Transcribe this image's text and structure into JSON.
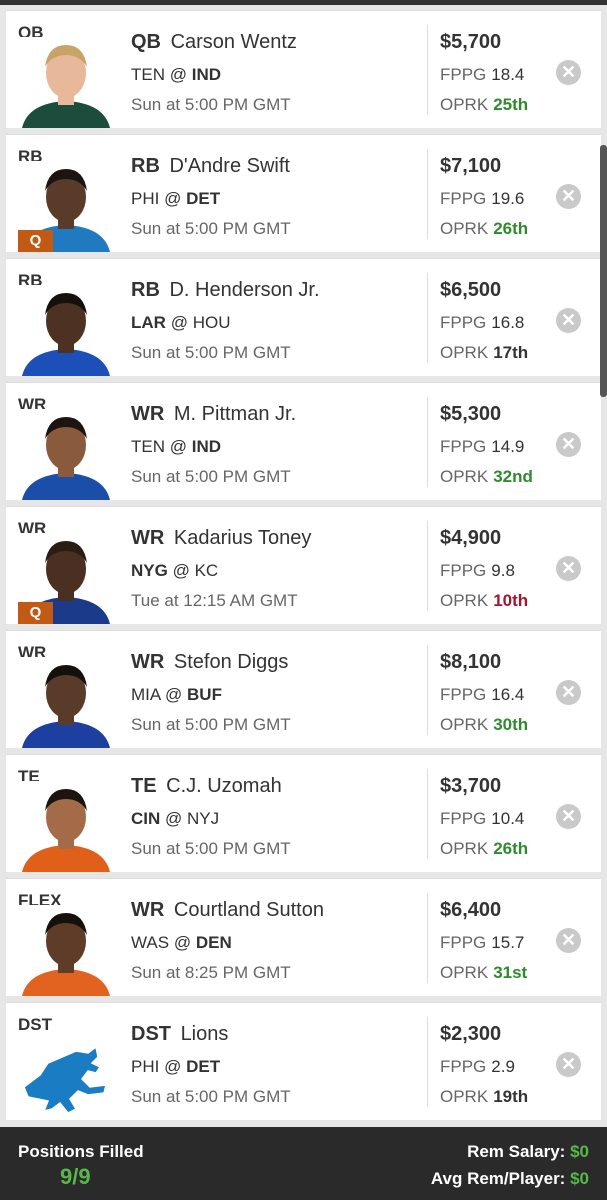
{
  "players": [
    {
      "slot": "QB",
      "pos": "QB",
      "name": "Carson Wentz",
      "team": "TEN",
      "at": "@",
      "opp": "IND",
      "bold_side": "opp",
      "time": "Sun at 5:00 PM GMT",
      "salary": "$5,700",
      "fppg_label": "FPPG",
      "fppg": "18.4",
      "oprk_label": "OPRK",
      "oprk": "25th",
      "oprk_tone": "good",
      "injury": "",
      "jersey_color": "#1c4d3c",
      "skin": "#e8b89a",
      "hair": "#c9a266"
    },
    {
      "slot": "RB",
      "pos": "RB",
      "name": "D'Andre Swift",
      "team": "PHI",
      "at": "@",
      "opp": "DET",
      "bold_side": "opp",
      "time": "Sun at 5:00 PM GMT",
      "salary": "$7,100",
      "fppg_label": "FPPG",
      "fppg": "19.6",
      "oprk_label": "OPRK",
      "oprk": "26th",
      "oprk_tone": "good",
      "injury": "Q",
      "jersey_color": "#1f7ac0",
      "skin": "#5a3b29",
      "hair": "#1b1410"
    },
    {
      "slot": "RB",
      "pos": "RB",
      "name": "D. Henderson Jr.",
      "team": "LAR",
      "at": "@",
      "opp": "HOU",
      "bold_side": "team",
      "time": "Sun at 5:00 PM GMT",
      "salary": "$6,500",
      "fppg_label": "FPPG",
      "fppg": "16.8",
      "oprk_label": "OPRK",
      "oprk": "17th",
      "oprk_tone": "neutral",
      "injury": "",
      "jersey_color": "#1d4fb8",
      "skin": "#4d3224",
      "hair": "#15100c"
    },
    {
      "slot": "WR",
      "pos": "WR",
      "name": "M. Pittman Jr.",
      "team": "TEN",
      "at": "@",
      "opp": "IND",
      "bold_side": "opp",
      "time": "Sun at 5:00 PM GMT",
      "salary": "$5,300",
      "fppg_label": "FPPG",
      "fppg": "14.9",
      "oprk_label": "OPRK",
      "oprk": "32nd",
      "oprk_tone": "good",
      "injury": "",
      "jersey_color": "#1a4ea8",
      "skin": "#8a5a3c",
      "hair": "#1b1410"
    },
    {
      "slot": "WR",
      "pos": "WR",
      "name": "Kadarius Toney",
      "team": "NYG",
      "at": "@",
      "opp": "KC",
      "bold_side": "team",
      "time": "Tue at 12:15 AM GMT",
      "salary": "$4,900",
      "fppg_label": "FPPG",
      "fppg": "9.8",
      "oprk_label": "OPRK",
      "oprk": "10th",
      "oprk_tone": "bad",
      "injury": "Q",
      "jersey_color": "#1c3a8a",
      "skin": "#4a2f22",
      "hair": "#2a1d14"
    },
    {
      "slot": "WR",
      "pos": "WR",
      "name": "Stefon Diggs",
      "team": "MIA",
      "at": "@",
      "opp": "BUF",
      "bold_side": "opp",
      "time": "Sun at 5:00 PM GMT",
      "salary": "$8,100",
      "fppg_label": "FPPG",
      "fppg": "16.4",
      "oprk_label": "OPRK",
      "oprk": "30th",
      "oprk_tone": "good",
      "injury": "",
      "jersey_color": "#1d3fa0",
      "skin": "#5a3a28",
      "hair": "#15100c"
    },
    {
      "slot": "TE",
      "pos": "TE",
      "name": "C.J. Uzomah",
      "team": "CIN",
      "at": "@",
      "opp": "NYJ",
      "bold_side": "team",
      "time": "Sun at 5:00 PM GMT",
      "salary": "$3,700",
      "fppg_label": "FPPG",
      "fppg": "10.4",
      "oprk_label": "OPRK",
      "oprk": "26th",
      "oprk_tone": "good",
      "injury": "",
      "jersey_color": "#e0601a",
      "skin": "#a36b48",
      "hair": "#1b1410"
    },
    {
      "slot": "FLEX",
      "pos": "WR",
      "name": "Courtland Sutton",
      "team": "WAS",
      "at": "@",
      "opp": "DEN",
      "bold_side": "opp",
      "time": "Sun at 8:25 PM GMT",
      "salary": "$6,400",
      "fppg_label": "FPPG",
      "fppg": "15.7",
      "oprk_label": "OPRK",
      "oprk": "31st",
      "oprk_tone": "good",
      "injury": "",
      "jersey_color": "#e2631f",
      "skin": "#5e3c28",
      "hair": "#15100c"
    },
    {
      "slot": "DST",
      "pos": "DST",
      "name": "Lions",
      "team": "PHI",
      "at": "@",
      "opp": "DET",
      "bold_side": "opp",
      "time": "Sun at 5:00 PM GMT",
      "salary": "$2,300",
      "fppg_label": "FPPG",
      "fppg": "2.9",
      "oprk_label": "OPRK",
      "oprk": "19th",
      "oprk_tone": "neutral",
      "injury": "",
      "logo": "lion-logo",
      "logo_color": "#1a7dc4"
    }
  ],
  "remove_icon": "close-icon",
  "footer": {
    "positions_label": "Positions Filled",
    "positions_value": "9/9",
    "rem_salary_label": "Rem Salary:",
    "rem_salary_value": "$0",
    "avg_rem_label": "Avg Rem/Player:",
    "avg_rem_value": "$0"
  },
  "colors": {
    "good": "#2e8b2e",
    "bad": "#a3162e",
    "injury": "#c05a14",
    "footer_green": "#56b84a"
  }
}
